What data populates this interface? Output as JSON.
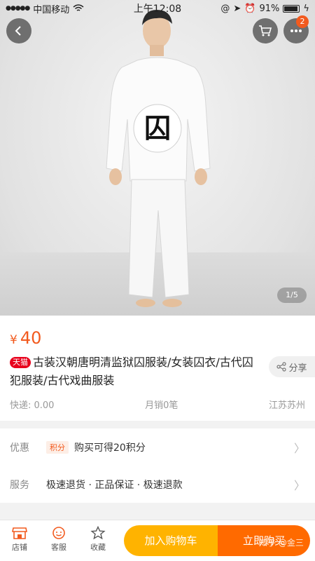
{
  "status_bar": {
    "carrier": "中国移动",
    "time": "上午12:08",
    "battery": "91%",
    "battery_level": 0.91
  },
  "hero": {
    "badge_char": "囚",
    "image_counter": "1/5",
    "notification_count": "2"
  },
  "product": {
    "price_currency": "¥",
    "price": "40",
    "store_tag": "天猫",
    "title": "古装汉朝唐明清监狱囚服装/女装囚衣/古代囚犯服装/古代戏曲服装",
    "share_label": "分享",
    "shipping": "快递: 0.00",
    "monthly_sales": "月销0笔",
    "location": "江苏苏州"
  },
  "service": {
    "promo_label": "优惠",
    "points_tag": "积分",
    "promo_text": "购买可得20积分",
    "service_label": "服务",
    "service_text": "极速退货 · 正品保证 · 极速退款"
  },
  "bottom_bar": {
    "store": "店铺",
    "support": "客服",
    "favorite": "收藏",
    "add_to_cart": "加入购物车",
    "buy_now": "立即购买"
  },
  "watermark": "知乎 @金三",
  "colors": {
    "accent": "#f25a1e",
    "tmall": "#e8001c",
    "cart_button": "#ffb300",
    "buy_button": "#ff6a00"
  }
}
